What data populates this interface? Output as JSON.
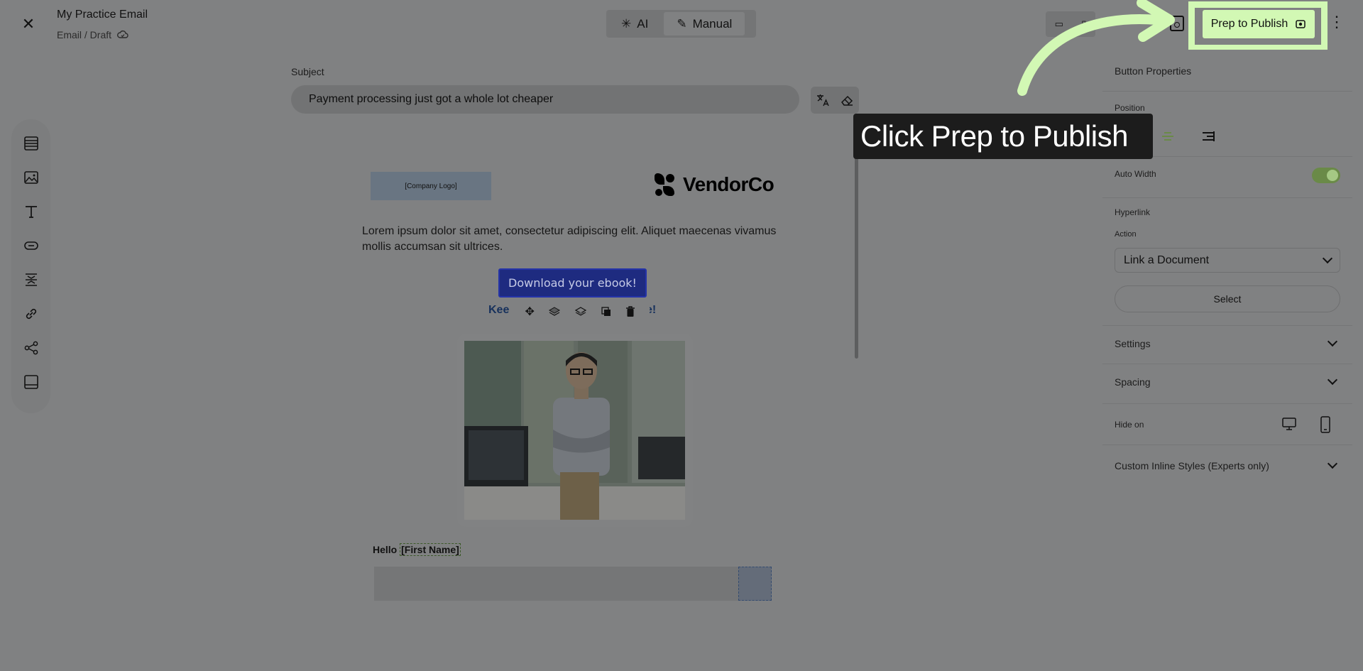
{
  "header": {
    "title": "My Practice Email",
    "breadcrumb": "Email / Draft",
    "modes": [
      {
        "label": "AI",
        "active": false
      },
      {
        "label": "Manual",
        "active": true
      }
    ],
    "publish_label": "Prep to Publish"
  },
  "subject": {
    "label": "Subject",
    "value": "Payment processing just got a whole lot cheaper"
  },
  "tools": [
    "rows-icon",
    "image-icon",
    "text-icon",
    "button-icon",
    "divider-icon",
    "link-icon",
    "social-icon",
    "footer-icon"
  ],
  "email": {
    "logo_placeholder": "[Company Logo]",
    "brand_name": "VendorCo",
    "body": "Lorem ipsum dolor sit amet, consectetur adipiscing elit. Aliquet maecenas vivamus mollis accumsan sit ultrices.",
    "cta_label": "Download your ebook!",
    "keep_text_start": "Kee",
    "keep_text_end": "e!",
    "greeting": "Hello",
    "greeting_merge": "[First Name]"
  },
  "panel": {
    "title": "Button Properties",
    "position_label": "Position",
    "auto_width_label": "Auto Width",
    "auto_width_on": true,
    "hyperlink_label": "Hyperlink",
    "action_label": "Action",
    "action_value": "Link a Document",
    "select_label": "Select",
    "sections": [
      "Settings",
      "Spacing"
    ],
    "hide_on_label": "Hide on",
    "custom_styles_label": "Custom Inline Styles (Experts only)"
  },
  "overlay": {
    "callout_text": "Click Prep to Publish",
    "highlight_color": "#d2f8b4"
  }
}
